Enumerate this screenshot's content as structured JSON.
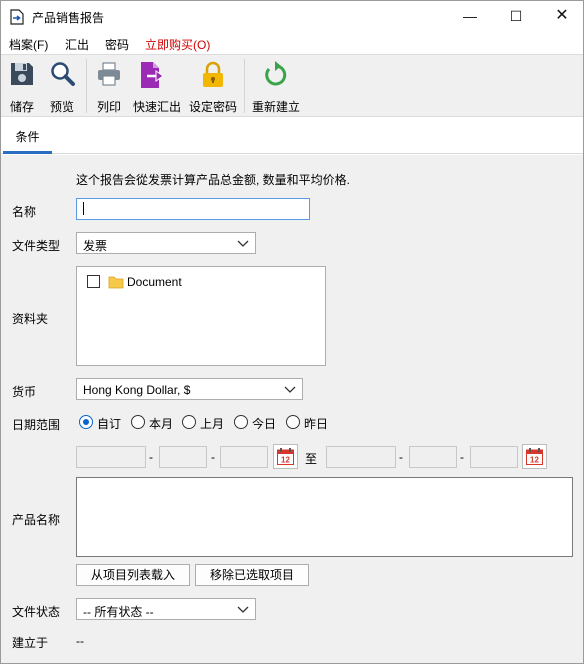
{
  "window": {
    "title": "产品销售报告",
    "minimize_glyph": "—",
    "maximize_glyph": "☐",
    "close_glyph": "✕"
  },
  "menu": {
    "items": [
      "档案(F)",
      "汇出",
      "密码",
      "立即购买(O)"
    ]
  },
  "toolbar": {
    "buttons": [
      {
        "label": "储存",
        "icon": "save-icon"
      },
      {
        "label": "预览",
        "icon": "magnifier-icon"
      },
      {
        "label": "列印",
        "icon": "printer-icon"
      },
      {
        "label": "快速汇出",
        "icon": "export-icon"
      },
      {
        "label": "设定密码",
        "icon": "lock-icon"
      },
      {
        "label": "重新建立",
        "icon": "refresh-icon"
      }
    ]
  },
  "tabs": [
    {
      "label": "条件",
      "active": true
    }
  ],
  "form": {
    "description": "这个报告会從发票计算产品总金额, 数量和平均价格.",
    "name_label": "名称",
    "name_value": "",
    "doc_type_label": "文件类型",
    "doc_type_value": "发票",
    "folder_label": "资料夹",
    "folders": [
      {
        "name": "Document",
        "checked": false
      }
    ],
    "currency_label": "货币",
    "currency_value": "Hong Kong Dollar, $",
    "date_range_label": "日期范围",
    "date_options": [
      {
        "label": "自订",
        "selected": true
      },
      {
        "label": "本月",
        "selected": false
      },
      {
        "label": "上月",
        "selected": false
      },
      {
        "label": "今日",
        "selected": false
      },
      {
        "label": "昨日",
        "selected": false
      }
    ],
    "date_sep": "-",
    "date_to": "至",
    "calendar_day": "12",
    "product_label": "产品名称",
    "load_button": "从项目列表载入",
    "remove_button": "移除已选取项目",
    "status_label": "文件状态",
    "status_value": "-- 所有状态 --",
    "created_label": "建立于",
    "created_value": "--"
  },
  "colors": {
    "accent": "#2b6ec1",
    "buy_menu": "#d40000",
    "save_icon": "#3a4a5c",
    "export_icon": "#9b2bb4",
    "lock_icon": "#f2b705",
    "refresh_icon": "#3aa34a",
    "folder_icon": "#f7c948",
    "calendar_icon": "#d9362b"
  }
}
